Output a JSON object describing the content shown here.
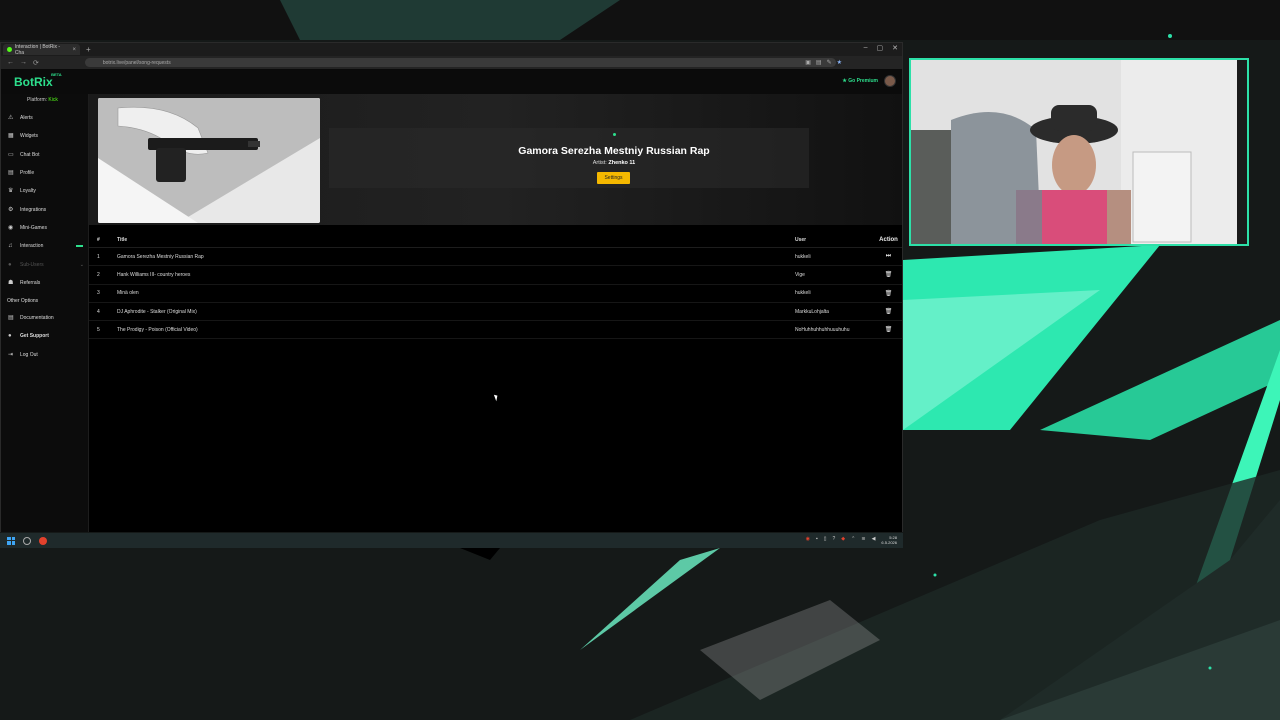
{
  "browser": {
    "tab_title": "Interaction | BotRix - Cha",
    "url": "botrix.live/panel/song-requests",
    "new_tab_symbol": "+",
    "back_symbol": "←",
    "forward_symbol": "→",
    "reload_symbol": "⟳"
  },
  "app": {
    "logo": "BotRix",
    "logo_badge": "BETA",
    "premium_label": "Go Premium",
    "platform_label": "Platform:",
    "platform_value": "Kick"
  },
  "sidebar": {
    "items": [
      {
        "label": "Alerts",
        "icon": "warning-icon"
      },
      {
        "label": "Widgets",
        "icon": "widgets-icon"
      },
      {
        "label": "Chat Bot",
        "icon": "chat-icon"
      },
      {
        "label": "Profile",
        "icon": "profile-icon"
      },
      {
        "label": "Loyalty",
        "icon": "trophy-icon"
      },
      {
        "label": "Integrations",
        "icon": "plug-icon"
      },
      {
        "label": "Mini-Games",
        "icon": "gamepad-icon"
      },
      {
        "label": "Interaction",
        "icon": "music-icon"
      },
      {
        "label": "Sub-Users",
        "icon": "users-icon"
      },
      {
        "label": "Referrals",
        "icon": "referral-icon"
      }
    ],
    "other_heading": "Other Options",
    "other_items": [
      {
        "label": "Documentation",
        "icon": "doc-icon"
      },
      {
        "label": "Get Support",
        "icon": "support-icon"
      },
      {
        "label": "Log Out",
        "icon": "logout-icon"
      }
    ]
  },
  "now_playing": {
    "title": "Gamora Serezha Mestniy Russian Rap",
    "artist_label": "Artist:",
    "artist": "Zhenko 11",
    "settings_label": "Settings"
  },
  "queue": {
    "headers": {
      "num": "#",
      "title": "Title",
      "user": "User",
      "action": "Action"
    },
    "rows": [
      {
        "num": "1",
        "title": "Gamora Serezha Mestniy Russian Rap",
        "user": "hukkeli",
        "action": "skip-icon"
      },
      {
        "num": "2",
        "title": "Hank Williams III- country heroes",
        "user": "Vige",
        "action": "trash-icon"
      },
      {
        "num": "3",
        "title": "Minä olen",
        "user": "hukkeli",
        "action": "trash-icon"
      },
      {
        "num": "4",
        "title": "DJ Aphrodite - Stalker (Original Mix)",
        "user": "MarkkuLohjalta",
        "action": "trash-icon"
      },
      {
        "num": "5",
        "title": "The Prodigy - Poison (Official Video)",
        "user": "NoHuhhuhhuhhuuuhuhu",
        "action": "trash-icon"
      }
    ]
  },
  "taskbar": {
    "time": "5:28",
    "date": "6.5.2026"
  },
  "colors": {
    "accent": "#2de08d",
    "kick_green": "#53fc18",
    "settings_button": "#f5b800",
    "cam_border": "#2de0a8"
  }
}
